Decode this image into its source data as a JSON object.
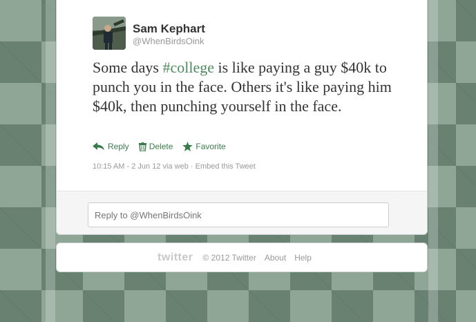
{
  "tweet": {
    "author_name": "Sam Kephart",
    "author_handle": "@WhenBirdsOink",
    "text_before": "Some days ",
    "hashtag": "#college",
    "text_after": " is like paying a guy $40k to punch you in the face. Others it's like paying him $40k, then punching yourself in the face.",
    "timestamp": "10:15 AM - 2 Jun 12 via web",
    "embed_label": "Embed this Tweet"
  },
  "actions": {
    "reply": "Reply",
    "delete": "Delete",
    "favorite": "Favorite"
  },
  "reply_box": {
    "placeholder": "Reply to @WhenBirdsOink"
  },
  "footer": {
    "logo": "twitter",
    "copyright": "© 2012 Twitter",
    "about": "About",
    "help": "Help"
  },
  "colors": {
    "accent_green": "#3a7b4d",
    "hashtag": "#4d8a5d",
    "background": "#8fa595"
  },
  "icons": {
    "reply": "reply-arrow-icon",
    "delete": "trash-icon",
    "favorite": "star-icon"
  }
}
